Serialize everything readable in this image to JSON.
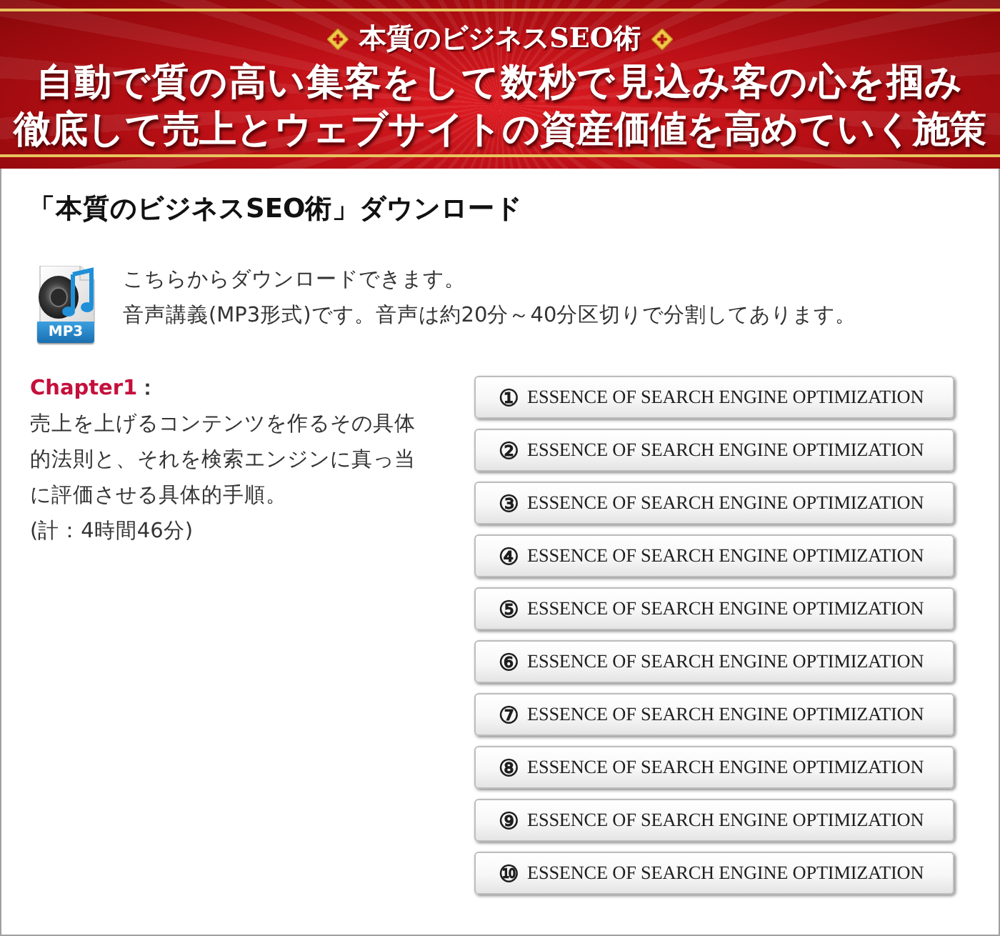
{
  "banner": {
    "subtitle": "本質のビジネスSEO術",
    "headline": [
      "自動で質の高い集客をして数秒で見込み客の心を掴み",
      "徹底して売上とウェブサイトの資産価値を高めていく施策"
    ]
  },
  "section": {
    "heading": "「本質のビジネスSEO術」ダウンロード",
    "file_type": "MP3",
    "intro": [
      "こちらからダウンロードできます。",
      "音声講義(MP3形式)です。音声は約20分～40分区切りで分割してあります。"
    ]
  },
  "chapter": {
    "title": "Chapter1",
    "title_suffix": "：",
    "description": "売上を上げるコンテンツを作るその具体的法則と、それを検索エンジンに真っ当に評価させる具体的手順。",
    "total": "(計：4時間46分)"
  },
  "downloads": [
    {
      "number": "①",
      "label": "ESSENCE OF SEARCH ENGINE OPTIMIZATION"
    },
    {
      "number": "②",
      "label": "ESSENCE OF SEARCH ENGINE OPTIMIZATION"
    },
    {
      "number": "③",
      "label": "ESSENCE OF SEARCH ENGINE OPTIMIZATION"
    },
    {
      "number": "④",
      "label": "ESSENCE OF SEARCH ENGINE OPTIMIZATION"
    },
    {
      "number": "⑤",
      "label": "ESSENCE OF SEARCH ENGINE OPTIMIZATION"
    },
    {
      "number": "⑥",
      "label": "ESSENCE OF SEARCH ENGINE OPTIMIZATION"
    },
    {
      "number": "⑦",
      "label": "ESSENCE OF SEARCH ENGINE OPTIMIZATION"
    },
    {
      "number": "⑧",
      "label": "ESSENCE OF SEARCH ENGINE OPTIMIZATION"
    },
    {
      "number": "⑨",
      "label": "ESSENCE OF SEARCH ENGINE OPTIMIZATION"
    },
    {
      "number": "⑩",
      "label": "ESSENCE OF SEARCH ENGINE OPTIMIZATION"
    }
  ]
}
